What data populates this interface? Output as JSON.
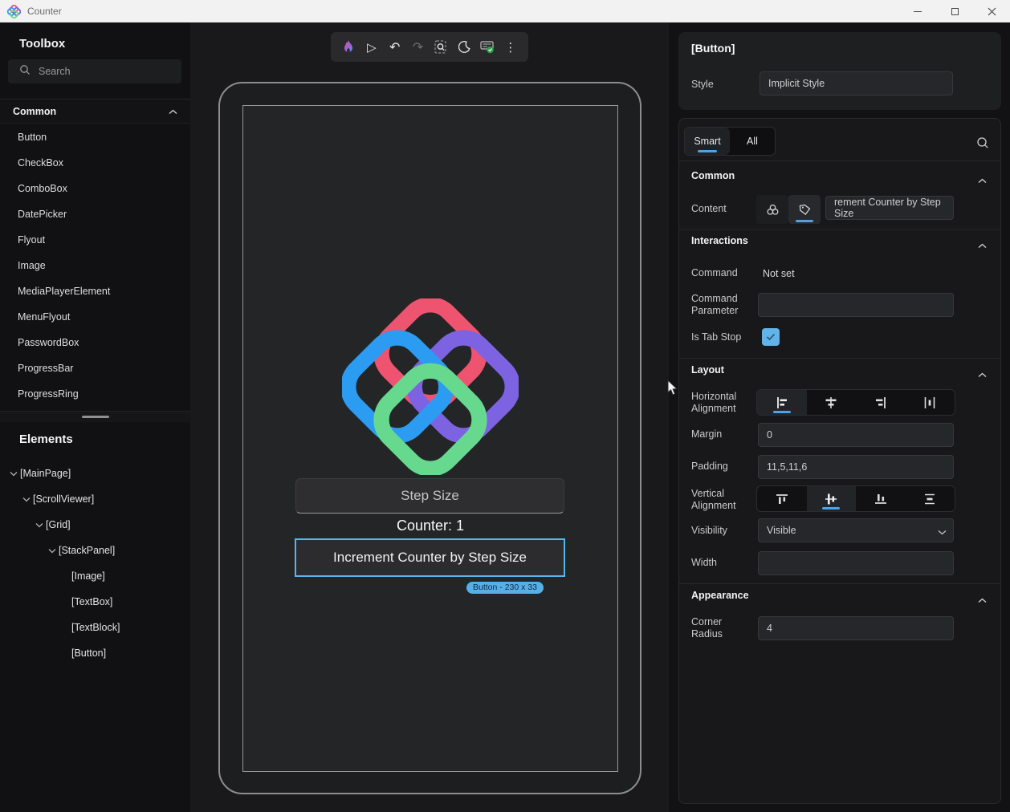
{
  "titlebar": {
    "title": "Counter"
  },
  "toolbox": {
    "title": "Toolbox",
    "search_placeholder": "Search",
    "section_header": "Common",
    "items": [
      "Button",
      "CheckBox",
      "ComboBox",
      "DatePicker",
      "Flyout",
      "Image",
      "MediaPlayerElement",
      "MenuFlyout",
      "PasswordBox",
      "ProgressBar",
      "ProgressRing"
    ]
  },
  "elements_panel": {
    "title": "Elements",
    "tree": [
      {
        "label": "[MainPage]"
      },
      {
        "label": "[ScrollViewer]"
      },
      {
        "label": "[Grid]"
      },
      {
        "label": "[StackPanel]"
      },
      {
        "label": "[Image]"
      },
      {
        "label": "[TextBox]"
      },
      {
        "label": "[TextBlock]"
      },
      {
        "label": "[Button]"
      }
    ]
  },
  "toolbar": {
    "icons": [
      "hot-reload-flame",
      "play",
      "undo",
      "redo",
      "zoom-selection",
      "theme-moon",
      "status-connected",
      "more-options"
    ]
  },
  "canvas": {
    "textbox_placeholder": "Step Size",
    "counter_label": "Counter: 1",
    "button_label": "Increment Counter by Step Size",
    "selection_badge": "Button - 230 x 33"
  },
  "properties": {
    "selected_element": "[Button]",
    "style_label": "Style",
    "style_value": "Implicit Style",
    "tab_smart": "Smart",
    "tab_all": "All",
    "common": {
      "title": "Common",
      "content_label": "Content",
      "content_value": "rement Counter by Step Size"
    },
    "interactions": {
      "title": "Interactions",
      "command_label": "Command",
      "command_value": "Not set",
      "command_parameter_label": "Command Parameter",
      "is_tab_stop_label": "Is Tab Stop"
    },
    "layout": {
      "title": "Layout",
      "horizontal_alignment_label": "Horizontal Alignment",
      "margin_label": "Margin",
      "margin_value": "0",
      "padding_label": "Padding",
      "padding_value": "11,5,11,6",
      "vertical_alignment_label": "Vertical Alignment",
      "visibility_label": "Visibility",
      "visibility_value": "Visible",
      "width_label": "Width"
    },
    "appearance": {
      "title": "Appearance",
      "corner_radius_label": "Corner Radius",
      "corner_radius_value": "4"
    }
  },
  "colors": {
    "accent_blue": "#4da2e8",
    "selection_blue": "#57b6ec",
    "badge_blue": "#57afe8",
    "checkbox_blue": "#61b3e9",
    "logo_red": "#ee5470",
    "logo_blue": "#2b9cf2",
    "logo_purple": "#7d63e2",
    "logo_green": "#67d98f",
    "status_green": "#2e9e4f"
  }
}
